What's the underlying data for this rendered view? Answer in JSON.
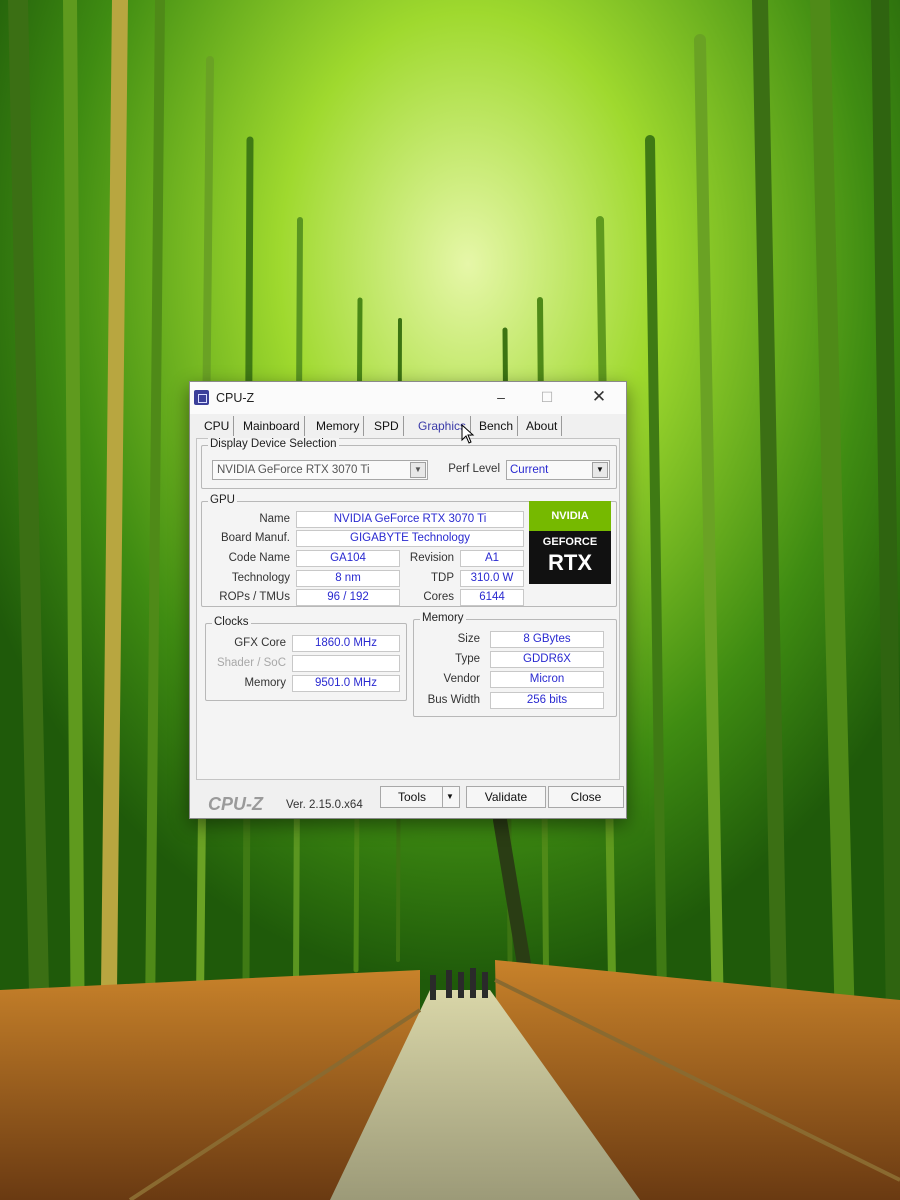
{
  "window": {
    "title": "CPU-Z",
    "controls": {
      "minimize": "–",
      "maximize": "☐",
      "close": "✕"
    }
  },
  "tabs": [
    "CPU",
    "Mainboard",
    "Memory",
    "SPD",
    "Graphics",
    "Bench",
    "About"
  ],
  "active_tab": "Graphics",
  "display_device": {
    "group_label": "Display Device Selection",
    "device": "NVIDIA GeForce RTX 3070 Ti",
    "perf_level_label": "Perf Level",
    "perf_level": "Current"
  },
  "gpu": {
    "group_label": "GPU",
    "name_label": "Name",
    "name": "NVIDIA GeForce RTX 3070 Ti",
    "board_label": "Board Manuf.",
    "board": "GIGABYTE Technology",
    "code_name_label": "Code Name",
    "code_name": "GA104",
    "revision_label": "Revision",
    "revision": "A1",
    "technology_label": "Technology",
    "technology": "8 nm",
    "tdp_label": "TDP",
    "tdp": "310.0 W",
    "rops_label": "ROPs / TMUs",
    "rops": "96 / 192",
    "cores_label": "Cores",
    "cores": "6144",
    "logo_brand": "NVIDIA",
    "logo_line1": "GEFORCE",
    "logo_line2": "RTX"
  },
  "clocks": {
    "group_label": "Clocks",
    "gfx_core_label": "GFX Core",
    "gfx_core": "1860.0 MHz",
    "shader_label": "Shader / SoC",
    "shader": "",
    "memory_label": "Memory",
    "memory": "9501.0 MHz"
  },
  "memory": {
    "group_label": "Memory",
    "size_label": "Size",
    "size": "8 GBytes",
    "type_label": "Type",
    "type": "GDDR6X",
    "vendor_label": "Vendor",
    "vendor": "Micron",
    "bus_width_label": "Bus Width",
    "bus_width": "256 bits"
  },
  "footer": {
    "brand": "CPU-Z",
    "version": "Ver. 2.15.0.x64",
    "tools": "Tools",
    "validate": "Validate",
    "close": "Close"
  }
}
